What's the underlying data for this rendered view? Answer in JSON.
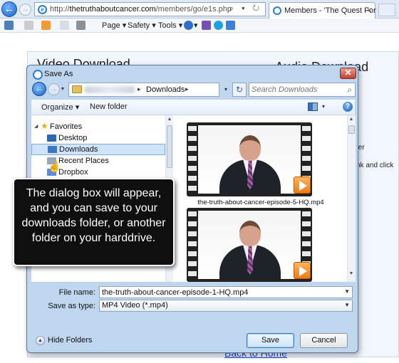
{
  "browser": {
    "url_domain": "thetruthaboutcancer.com",
    "url_path": "/members/go/e1s.php",
    "url_prefix": "http://",
    "url_icons": "⌕ ▾ ↻",
    "tab_title": "Members - 'The Quest For ...",
    "tab_close": "×",
    "back_glyph": "←",
    "forward_glyph": "→",
    "commands": {
      "page": "Page ▾",
      "safety": "Safety ▾",
      "tools": "Tools ▾",
      "help": "▾"
    }
  },
  "page_behind": {
    "left_heading": "Video Download",
    "right_heading": "Audio Download",
    "side_text_1": "ter",
    "side_text_2": "nk and click",
    "link_text": "Back to Home"
  },
  "dialog": {
    "title": "Save As",
    "close_glyph": "✕",
    "back_glyph": "←",
    "forward_glyph": "→",
    "history_glyph": "▾",
    "crumb_separator": "▸",
    "breadcrumb_current": "Downloads",
    "refresh_glyph": "↻",
    "search_placeholder": "Search Downloads",
    "search_glyph": "⌕",
    "toolbar": {
      "organize": "Organize ▾",
      "new_folder": "New folder",
      "view_arrow": "▾",
      "help_glyph": "?"
    },
    "nav": {
      "favorites": "Favorites",
      "expand_glyph": "◢",
      "star_glyph": "★",
      "items": [
        "Desktop",
        "Downloads",
        "Recent Places",
        "Dropbox"
      ]
    },
    "files": [
      {
        "name": "the-truth-about-cancer-episode-5-HQ.mp4"
      },
      {
        "name": "the-truth-about-cancer-episode-1-HQ.mp4"
      }
    ],
    "scroll_up_glyph": "▲",
    "scroll_down_glyph": "▼",
    "file_name_label": "File name:",
    "file_name_value": "the-truth-about-cancer-episode-1-HQ.mp4",
    "save_as_type_label": "Save as type:",
    "save_as_type_value": "MP4 Video (*.mp4)",
    "dropdown_glyph": "▼",
    "hide_folders_glyph": "▲",
    "hide_folders": "Hide Folders",
    "save": "Save",
    "cancel": "Cancel"
  },
  "callout": {
    "text": "The dialog box will appear, and you can save to your downloads folder, or another folder on your harddrive."
  },
  "cursor_glyph": "☝",
  "colors": {
    "accent": "#2a7bd8",
    "selection": "#cfe4fb",
    "callout_bg": "#0f0f0f",
    "link": "#1a4ccf"
  }
}
